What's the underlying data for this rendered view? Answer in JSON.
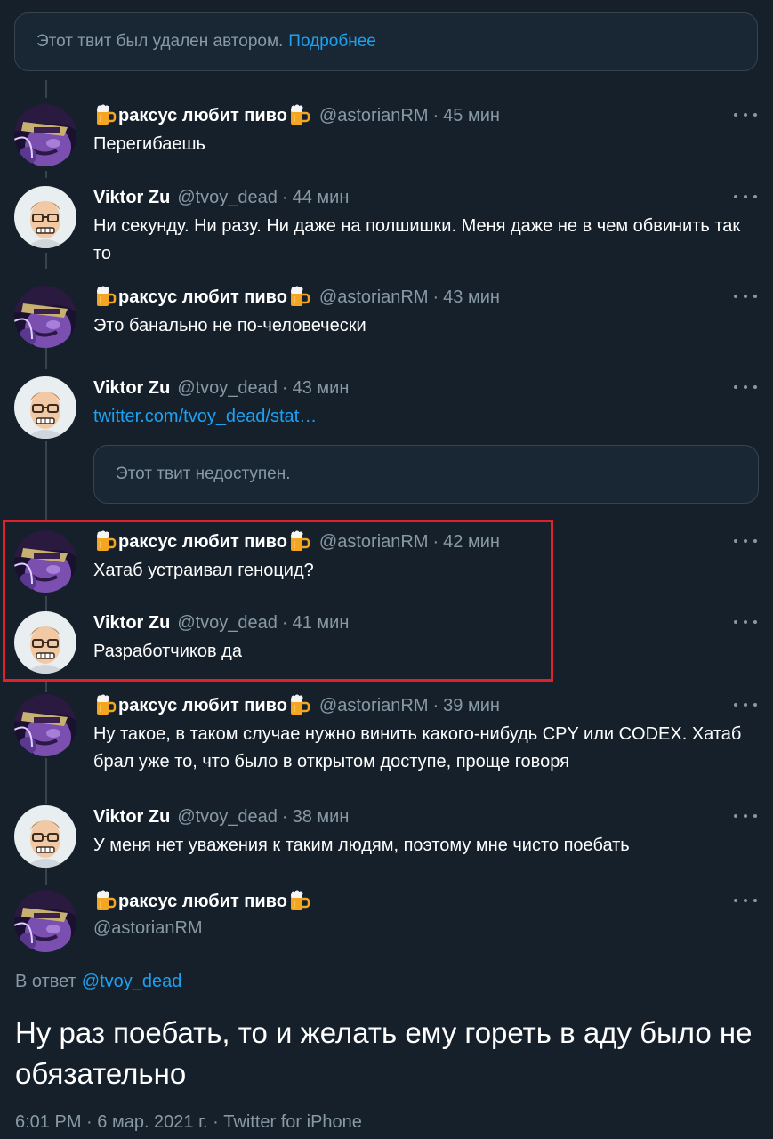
{
  "notice": {
    "text": "Этот твит был удален автором.",
    "link": "Подробнее"
  },
  "tweets": [
    {
      "name": "ракcус любит пиво",
      "handle": "@astorianRM",
      "time": "45 мин",
      "text": "Перегибаешь"
    },
    {
      "name": "Viktor Zu",
      "handle": "@tvoy_dead",
      "time": "44 мин",
      "text": "Ни секунду. Ни разу. Ни даже на полшишки. Меня даже не в чем обвинить так то"
    },
    {
      "name": "ракcус любит пиво",
      "handle": "@astorianRM",
      "time": "43 мин",
      "text": "Это банально не по-человечески"
    },
    {
      "name": "Viktor Zu",
      "handle": "@tvoy_dead",
      "time": "43 мин",
      "text": "twitter.com/tvoy_dead/stat…"
    },
    {
      "name": "ракcус любит пиво",
      "handle": "@astorianRM",
      "time": "42 мин",
      "text": "Хатаб устраивал геноцид?"
    },
    {
      "name": "Viktor Zu",
      "handle": "@tvoy_dead",
      "time": "41 мин",
      "text": "Разработчиков да"
    },
    {
      "name": "ракcус любит пиво",
      "handle": "@astorianRM",
      "time": "39 мин",
      "text": "Ну такое, в таком случае нужно винить какого-нибудь CPY или CODEX. Хатаб брал уже то, что было в открытом доступе, проще говоря"
    },
    {
      "name": "Viktor Zu",
      "handle": "@tvoy_dead",
      "time": "38 мин",
      "text": "У меня нет уважения к таким людям, поэтому мне чисто поебать"
    }
  ],
  "quote": {
    "text": "Этот твит недоступен."
  },
  "main": {
    "name": "ракcус любит пиво",
    "handle": "@astorianRM",
    "reply_prefix": "В ответ",
    "reply_handle": "@tvoy_dead",
    "text": "Ну раз поебать, то и желать ему гореть в аду было не обязательно",
    "time": "6:01 PM",
    "date": "6 мар. 2021 г.",
    "source": "Twitter for iPhone"
  },
  "colors": {
    "background": "#15202b",
    "secondary_text": "#8899a6",
    "link": "#1da1f2",
    "highlight_border": "#e0202a"
  }
}
